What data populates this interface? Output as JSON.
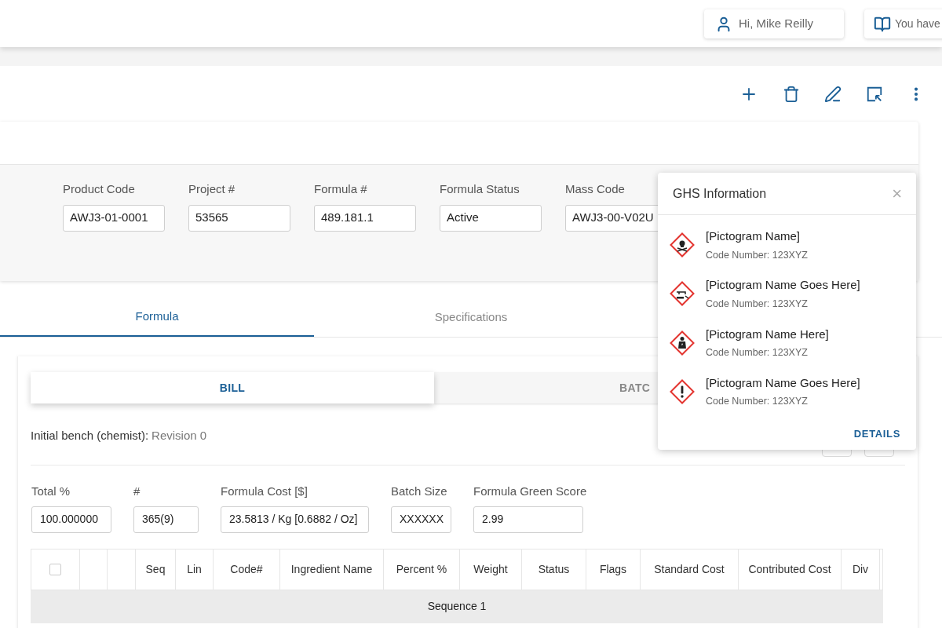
{
  "header": {
    "user_greeting": "Hi, Mike Reilly",
    "notifications": "You have"
  },
  "product_fields": [
    {
      "label": "Product Code",
      "value": "AWJ3-01-0001"
    },
    {
      "label": "Project #",
      "value": "53565"
    },
    {
      "label": "Formula #",
      "value": "489.181.1"
    },
    {
      "label": "Formula Status",
      "value": "Active"
    },
    {
      "label": "Mass Code",
      "value": "AWJ3-00-V02U"
    }
  ],
  "tabs": [
    {
      "label": "Formula",
      "selected": true
    },
    {
      "label": "Specifications",
      "selected": false
    }
  ],
  "subtabs": [
    {
      "label": "BILL",
      "selected": true
    },
    {
      "label": "BATC",
      "selected": false
    }
  ],
  "revision": {
    "label": "Initial bench (chemist):",
    "value": "Revision 0"
  },
  "summary_fields": [
    {
      "label": "Total %",
      "value": "100.000000"
    },
    {
      "label": "#",
      "value": "365(9)"
    },
    {
      "label": "Formula Cost [$]",
      "value": "23.5813 / Kg [0.6882 / Oz]"
    },
    {
      "label": "Batch Size",
      "value": "XXXXXX"
    },
    {
      "label": "Formula Green Score",
      "value": "2.99"
    }
  ],
  "table": {
    "select_all_checked": false,
    "columns": [
      "Seq",
      "Lin",
      "Code#",
      "Ingredient Name",
      "Percent %",
      "Weight",
      "Status",
      "Flags",
      "Standard Cost",
      "Contributed Cost",
      "Div"
    ],
    "group_row": "Sequence 1"
  },
  "ghs_popover": {
    "title": "GHS Information",
    "close": "×",
    "items": [
      {
        "kind": "skull",
        "name": "[Pictogram Name]",
        "code": "Code Number: 123XYZ"
      },
      {
        "kind": "corrosion",
        "name": "[Pictogram Name Goes Here]",
        "code": "Code Number: 123XYZ"
      },
      {
        "kind": "health",
        "name": "[Pictogram Name Here]",
        "code": "Code Number: 123XYZ"
      },
      {
        "kind": "exclamation",
        "name": "[Pictogram Name Goes Here]",
        "code": "Code Number: 123XYZ"
      }
    ],
    "action": "DETAILS"
  }
}
